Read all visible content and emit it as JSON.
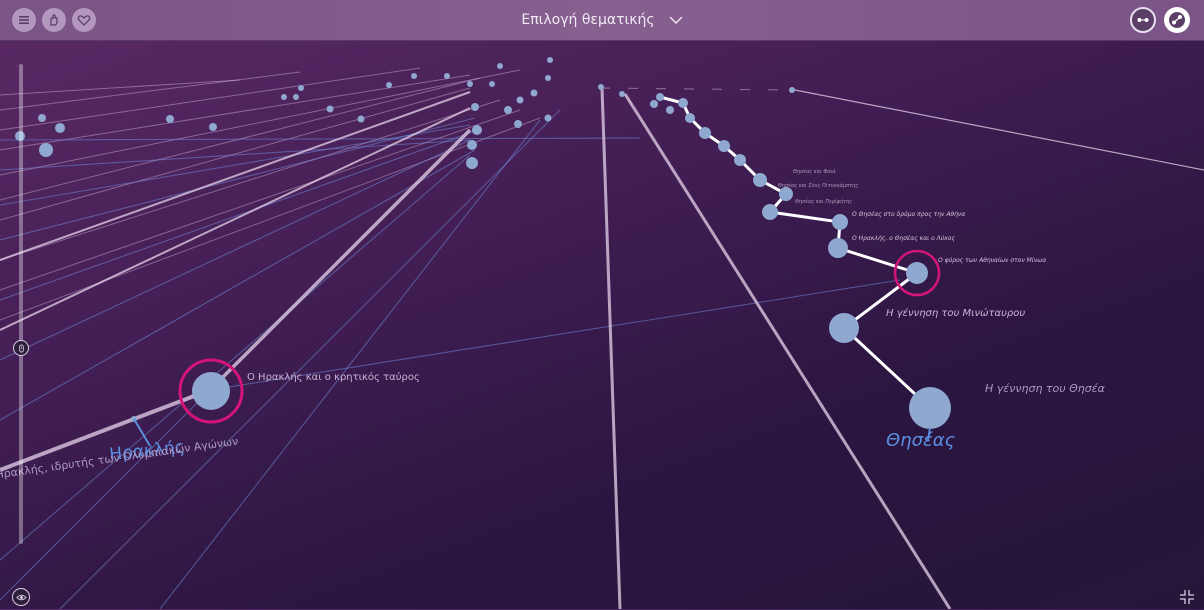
{
  "header": {
    "title": "Επιλογή θεματικής",
    "left_icons": [
      "menu-icon",
      "hand-icon",
      "heart-icon"
    ],
    "right_icons": [
      "link-view-icon",
      "graph-view-icon"
    ]
  },
  "nodes": {
    "heracles_label": "Ηρακλής",
    "heracles_event": "Ο Ηρακλής και ο κρητικός ταύρος",
    "heracles_olympics": "Ηρακλής, ιδρυτής των Ολυμπιακών Αγώνων",
    "theseus_label": "Θησέας",
    "theseus_birth": "Η γέννηση του Θησέα",
    "minotaur_birth": "Η γέννηση του Μινώταυρου",
    "athenians_tribute": "Ο φόρος των Αθηναίων στον Μίνωα",
    "heracles_theseus": "Ο Ηρακλής, ο Θησέας και ο Λύκος",
    "theseus_road": "Ο Θησέας στο δρόμο προς την Αθήνα",
    "small1": "Θησέας και Περίφήτης",
    "small2": "Θησέας και Σίνις Πιτυοκάμπτης",
    "small3": "Θησέας και Φαιά"
  },
  "controls": {
    "slider_icon": "scroll-icon",
    "eye_icon": "eye-icon",
    "collapse_icon": "collapse-icon"
  },
  "colors": {
    "background": "#3d1c50",
    "node_fill": "#8ea8d0",
    "highlight_ring": "#d4147a",
    "edge_blue": "#5b72c8",
    "edge_white": "#e8e0ee"
  }
}
